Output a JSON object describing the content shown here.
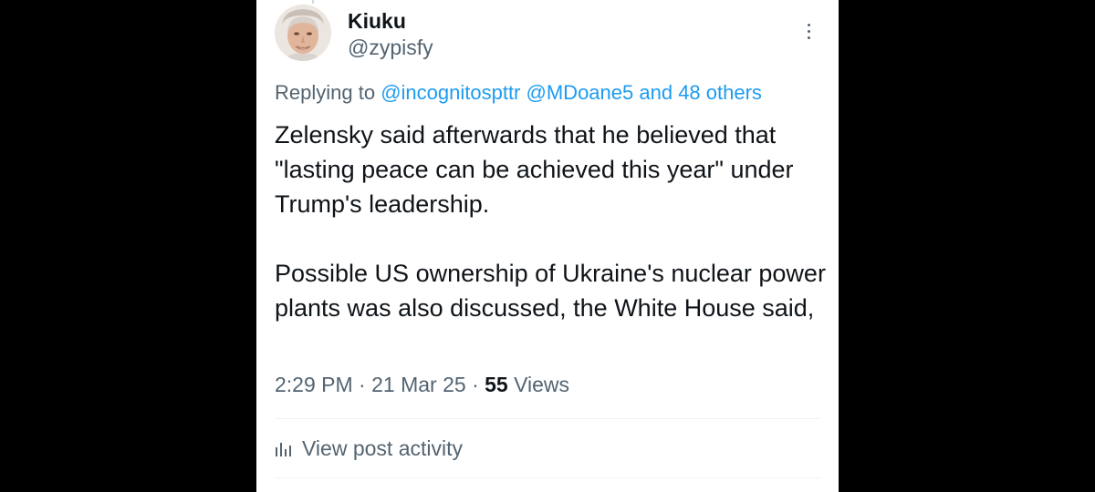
{
  "tweet": {
    "author": {
      "display_name": "Kiuku",
      "handle": "@zypisfy"
    },
    "replying_to": {
      "prefix": "Replying to",
      "mentions": [
        "@incognitospttr",
        "@MDoane5"
      ],
      "others": "and 48 others"
    },
    "paragraphs": [
      "Zelensky said afterwards that he believed that \"lasting peace can be achieved this year\" under Trump's leadership.",
      "Possible US ownership of Ukraine's nuclear power plants was also discussed, the White House said,"
    ],
    "time": "2:29 PM",
    "date": "21 Mar 25",
    "views_count": "55",
    "views_label": "Views",
    "activity_label": "View post activity"
  },
  "icons": {
    "more": "more-vertical-icon",
    "activity": "bar-chart-icon"
  },
  "colors": {
    "link": "#1d9bf0",
    "text": "#0f1419",
    "secondary": "#536471",
    "background": "#ffffff",
    "letterbox": "#000000"
  }
}
